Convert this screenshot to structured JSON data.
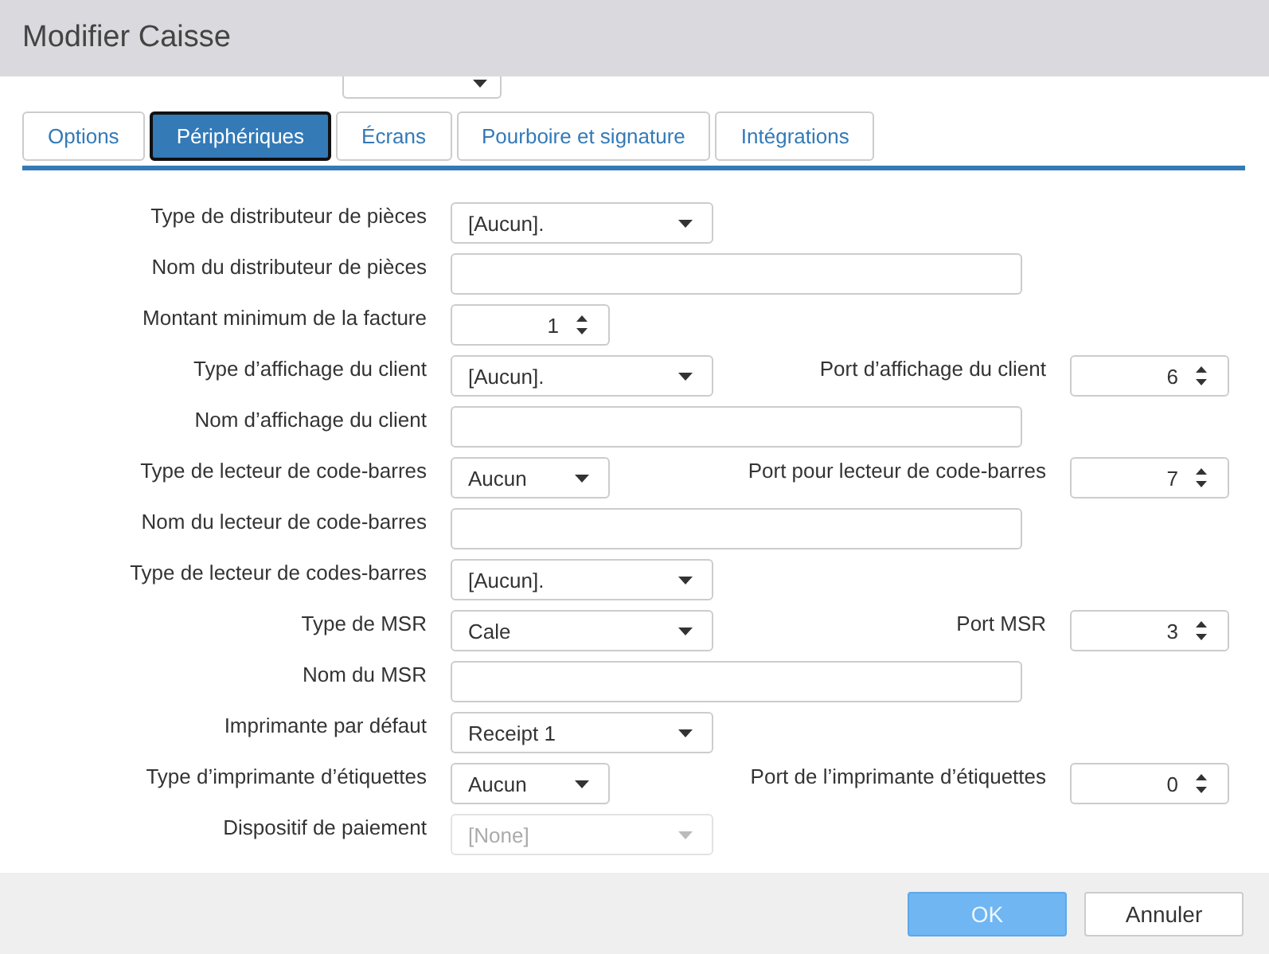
{
  "window": {
    "title": "Modifier Caisse"
  },
  "tabs": [
    {
      "label": "Options",
      "selected": false
    },
    {
      "label": "Périphériques",
      "selected": true
    },
    {
      "label": "Écrans",
      "selected": false
    },
    {
      "label": "Pourboire et signature",
      "selected": false
    },
    {
      "label": "Intégrations",
      "selected": false
    }
  ],
  "fields": [
    {
      "label": "Type de distributeur de pièces",
      "kind": "select",
      "value": "[Aucun].",
      "disabled": false
    },
    {
      "label": "Nom du distributeur de pièces",
      "kind": "text",
      "disabled": false
    },
    {
      "label": "Montant minimum de la facture",
      "kind": "spinner",
      "value": "1",
      "disabled": false
    },
    {
      "label": "Type d’affichage du client",
      "kind": "select",
      "value": "[Aucun].",
      "disabled": false,
      "port": {
        "label": "Port d’affichage du client",
        "value": "6"
      }
    },
    {
      "label": "Nom d’affichage du client",
      "kind": "text",
      "disabled": false
    },
    {
      "label": "Type de lecteur de code-barres",
      "kind": "short-select",
      "value": "Aucun",
      "disabled": false,
      "port": {
        "label": "Port pour lecteur de code-barres",
        "value": "7"
      }
    },
    {
      "label": "Nom du lecteur de code-barres",
      "kind": "text",
      "disabled": false
    },
    {
      "label": "Type de lecteur de codes-barres",
      "kind": "select",
      "value": "[Aucun].",
      "disabled": false
    },
    {
      "label": "Type de MSR",
      "kind": "select",
      "value": "Cale",
      "disabled": false,
      "port": {
        "label": "Port MSR",
        "value": "3"
      }
    },
    {
      "label": "Nom du MSR",
      "kind": "text",
      "disabled": false
    },
    {
      "label": "Imprimante par défaut",
      "kind": "select",
      "value": "Receipt 1",
      "disabled": false
    },
    {
      "label": "Type d’imprimante d’étiquettes",
      "kind": "short-select",
      "value": "Aucun",
      "disabled": false,
      "port": {
        "label": "Port de l’imprimante d’étiquettes",
        "value": "0"
      }
    },
    {
      "label": "Dispositif de paiement",
      "kind": "select",
      "value": "[None]",
      "disabled": true
    }
  ],
  "buttons": [
    {
      "label": "OK",
      "kind": "primary"
    },
    {
      "label": "Annuler",
      "kind": "default"
    }
  ]
}
